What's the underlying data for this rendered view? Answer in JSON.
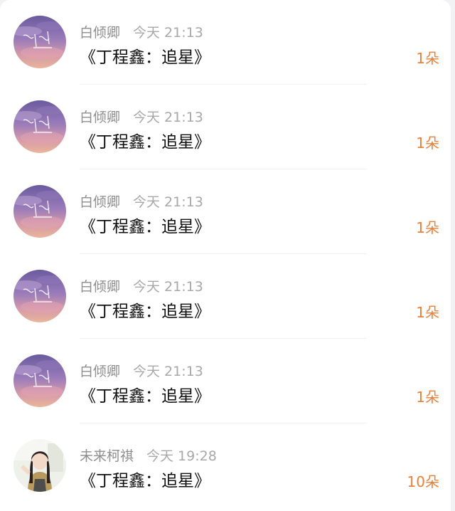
{
  "colors": {
    "accent": "#e8803a",
    "meta_text": "#999999",
    "title_text": "#111111",
    "background": "#f2f2f4"
  },
  "gifts": [
    {
      "avatar_icon": "sunset-sky-avatar-icon",
      "name": "白倾卿",
      "time": "今天 21:13",
      "title": "《丁程鑫：追星》",
      "count": "1朵"
    },
    {
      "avatar_icon": "sunset-sky-avatar-icon",
      "name": "白倾卿",
      "time": "今天 21:13",
      "title": "《丁程鑫：追星》",
      "count": "1朵"
    },
    {
      "avatar_icon": "sunset-sky-avatar-icon",
      "name": "白倾卿",
      "time": "今天 21:13",
      "title": "《丁程鑫：追星》",
      "count": "1朵"
    },
    {
      "avatar_icon": "sunset-sky-avatar-icon",
      "name": "白倾卿",
      "time": "今天 21:13",
      "title": "《丁程鑫：追星》",
      "count": "1朵"
    },
    {
      "avatar_icon": "sunset-sky-avatar-icon",
      "name": "白倾卿",
      "time": "今天 21:13",
      "title": "《丁程鑫：追星》",
      "count": "1朵"
    },
    {
      "avatar_icon": "girl-portrait-avatar-icon",
      "name": "未来柯祺",
      "time": "今天 19:28",
      "title": "《丁程鑫：追星》",
      "count": "10朵"
    }
  ]
}
